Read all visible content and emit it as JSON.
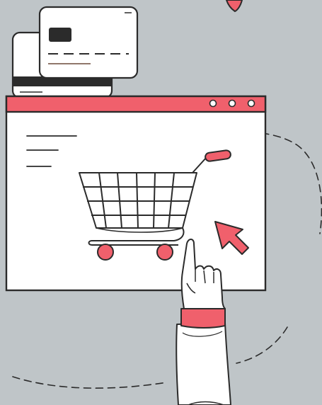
{
  "colors": {
    "background": "#bfc5c8",
    "accent": "#f0606c",
    "outline": "#2b2b2b",
    "paper": "#ffffff",
    "hand_shadow": "#e9eaeb"
  },
  "icons": [
    "credit-card-icon",
    "browser-window-icon",
    "shopping-cart-icon",
    "cursor-arrow-icon",
    "pointing-hand-icon"
  ]
}
